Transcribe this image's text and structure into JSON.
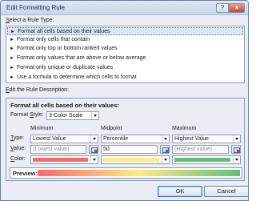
{
  "window": {
    "title": "Edit Formatting Rule",
    "help_label": "?",
    "close_label": "×"
  },
  "rule_type": {
    "label_key": "S",
    "label_rest": "elect a Rule Type:",
    "items": [
      {
        "label": "Format all cells based on their values",
        "selected": true
      },
      {
        "label": "Format only cells that contain",
        "selected": false
      },
      {
        "label": "Format only top or bottom ranked values",
        "selected": false
      },
      {
        "label": "Format only values that are above or below average",
        "selected": false
      },
      {
        "label": "Format only unique or duplicate values",
        "selected": false
      },
      {
        "label": "Use a formula to determine which cells to format",
        "selected": false
      }
    ],
    "arrow_glyph": "►"
  },
  "description": {
    "label_key": "E",
    "label_rest": "dit the Rule Description:",
    "heading": "Format all cells based on their values:",
    "format_style": {
      "label_pre": "Format ",
      "label_key": "S",
      "label_post": "tyle:",
      "value": "3-Color Scale"
    },
    "columns": {
      "minimum": "Minimum",
      "midpoint": "Midpoint",
      "maximum": "Maximum"
    },
    "row_labels": {
      "type_key": "T",
      "type_rest": "ype:",
      "value_key": "V",
      "value_rest": "alue:",
      "color_key": "C",
      "color_rest": "olor:"
    },
    "minimum": {
      "type": "Lowest Value",
      "value": "(Lowest value)",
      "color": "#f8696b"
    },
    "midpoint": {
      "type": "Percentile",
      "value": "50",
      "color": "#ffeb84"
    },
    "maximum": {
      "type": "Highest Value",
      "value": "(Highest value)",
      "color": "#63be7b"
    },
    "preview_label": "Preview:"
  },
  "buttons": {
    "ok": "OK",
    "cancel": "Cancel"
  }
}
